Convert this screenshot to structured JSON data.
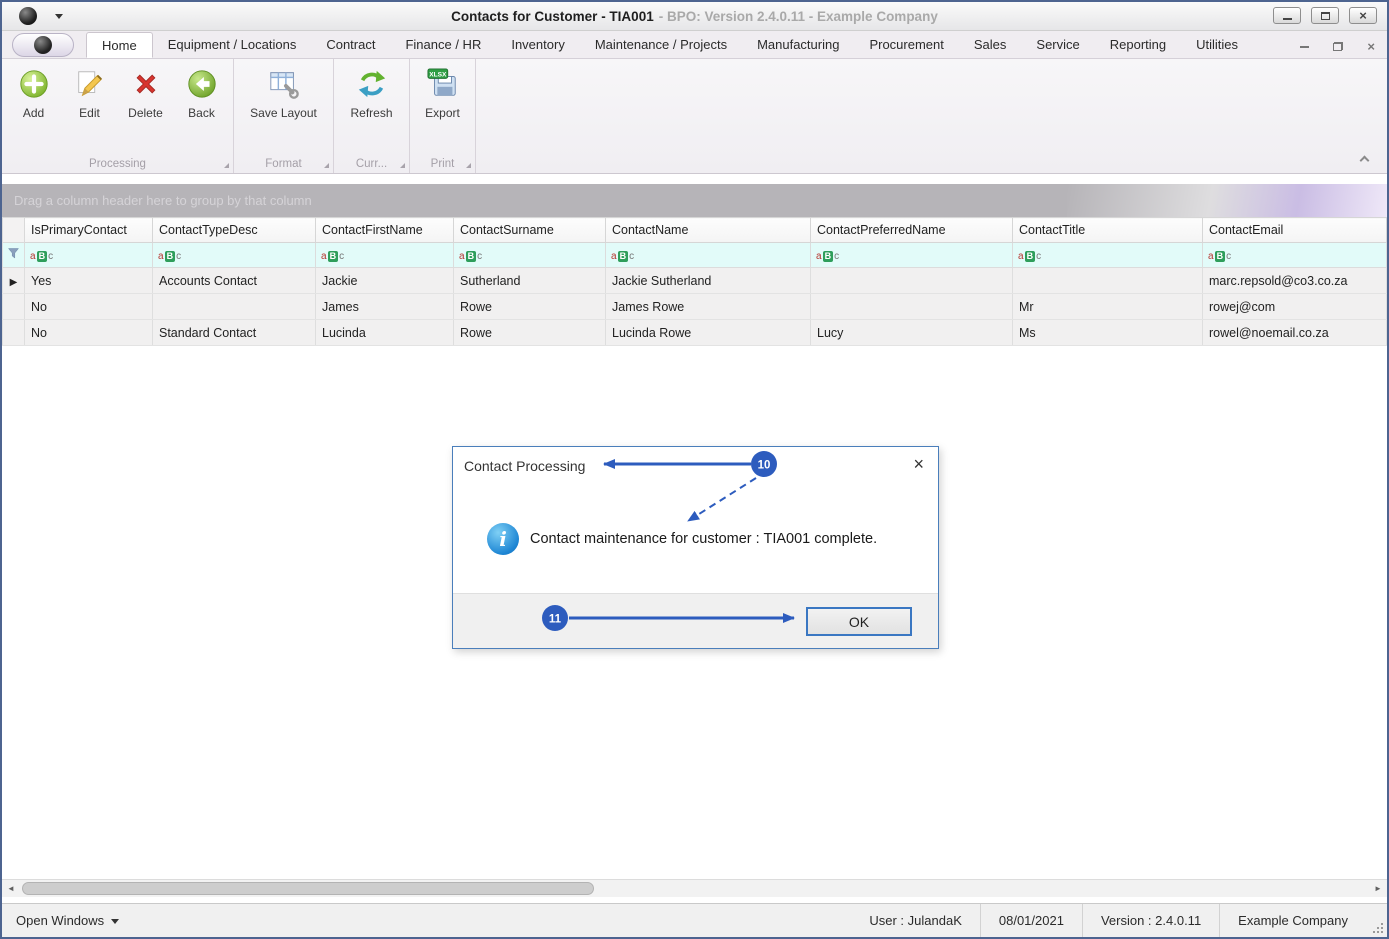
{
  "window": {
    "title_main": "Contacts for Customer - TIA001",
    "title_rest": "- BPO: Version 2.4.0.11 - Example Company"
  },
  "tabs": [
    {
      "label": "Home",
      "active": true
    },
    {
      "label": "Equipment / Locations"
    },
    {
      "label": "Contract"
    },
    {
      "label": "Finance / HR"
    },
    {
      "label": "Inventory"
    },
    {
      "label": "Maintenance / Projects"
    },
    {
      "label": "Manufacturing"
    },
    {
      "label": "Procurement"
    },
    {
      "label": "Sales"
    },
    {
      "label": "Service"
    },
    {
      "label": "Reporting"
    },
    {
      "label": "Utilities"
    }
  ],
  "ribbon": {
    "buttons": [
      {
        "label": "Add"
      },
      {
        "label": "Edit"
      },
      {
        "label": "Delete"
      },
      {
        "label": "Back"
      },
      {
        "label": "Save Layout"
      },
      {
        "label": "Refresh"
      },
      {
        "label": "Export"
      }
    ],
    "groups": [
      {
        "label": "Processing"
      },
      {
        "label": "Format"
      },
      {
        "label": "Curr..."
      },
      {
        "label": "Print"
      }
    ],
    "export_badge": "XLSX"
  },
  "grid": {
    "group_by_hint": "Drag a column header here to group by that column",
    "columns": [
      "IsPrimaryContact",
      "ContactTypeDesc",
      "ContactFirstName",
      "ContactSurname",
      "ContactName",
      "ContactPreferredName",
      "ContactTitle",
      "ContactEmail"
    ],
    "filter_badge": {
      "a": "a",
      "b": "B",
      "c": "c"
    },
    "rows": [
      {
        "IsPrimaryContact": "Yes",
        "ContactTypeDesc": "Accounts Contact",
        "ContactFirstName": "Jackie",
        "ContactSurname": "Sutherland",
        "ContactName": "Jackie Sutherland",
        "ContactPreferredName": "",
        "ContactTitle": "",
        "ContactEmail": "marc.repsold@co3.co.za",
        "current": true
      },
      {
        "IsPrimaryContact": "No",
        "ContactTypeDesc": "",
        "ContactFirstName": "James",
        "ContactSurname": "Rowe",
        "ContactName": "James Rowe",
        "ContactPreferredName": "",
        "ContactTitle": "Mr",
        "ContactEmail": "rowej@com",
        "current": false
      },
      {
        "IsPrimaryContact": "No",
        "ContactTypeDesc": "Standard Contact",
        "ContactFirstName": "Lucinda",
        "ContactSurname": "Rowe",
        "ContactName": "Lucinda Rowe",
        "ContactPreferredName": "Lucy",
        "ContactTitle": "Ms",
        "ContactEmail": "rowel@noemail.co.za",
        "current": false
      }
    ]
  },
  "dialog": {
    "title": "Contact Processing",
    "message": "Contact maintenance for customer : TIA001 complete.",
    "ok": "OK"
  },
  "annotations": {
    "step10": "10",
    "step11": "11"
  },
  "statusbar": {
    "open_windows": "Open Windows",
    "user": "User : JulandaK",
    "date": "08/01/2021",
    "version": "Version : 2.4.0.11",
    "company": "Example Company"
  }
}
